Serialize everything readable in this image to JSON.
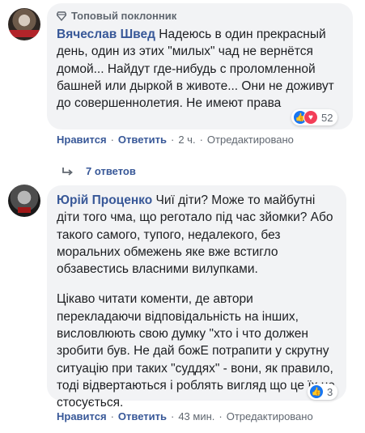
{
  "comment1": {
    "badge_label": "Топовый поклонник",
    "author": "Вячеслав Швед",
    "text": "Надеюсь в один прекрасный день, один из этих \"милых\" чад не вернётся домой... Найдут где-нибудь с проломленной башней или дыркой в животе... Они не доживут до совершеннолетия. Не имеют права",
    "reaction_count": "52",
    "reaction_icons": [
      "like-icon",
      "love-icon"
    ],
    "actions": {
      "like": "Нравится",
      "reply": "Ответить",
      "time": "2 ч.",
      "edited": "Отредактировано"
    },
    "replies_label": "7 ответов"
  },
  "comment2": {
    "author": "Юрій Проценко",
    "paragraph1": "Чиї діти? Може то майбутні діти того чма, що реготало під час зйомки? Або такого самого, тупого, недалекого, без моральних обмежень яке вже встигло обзавестись власними вилупками.",
    "paragraph2": "Цікаво читати коменти, де автори перекладаючи відповідальність на інших, висловлюють свою думку \"хто і что должен зробити був. Не дай божЕ потрапити у скрутну ситуацію при таких \"суддях\" - вони, як правило, тоді відвертаються і роблять вигляд що це їх не стосується.",
    "reaction_count": "3",
    "reaction_icons": [
      "like-icon"
    ],
    "actions": {
      "like": "Нравится",
      "reply": "Ответить",
      "time": "43 мин.",
      "edited": "Отредактировано"
    }
  },
  "colors": {
    "link": "#385898",
    "bubble": "#f2f3f5",
    "meta": "#606770",
    "like": "#1877f2",
    "love": "#f33e58"
  }
}
